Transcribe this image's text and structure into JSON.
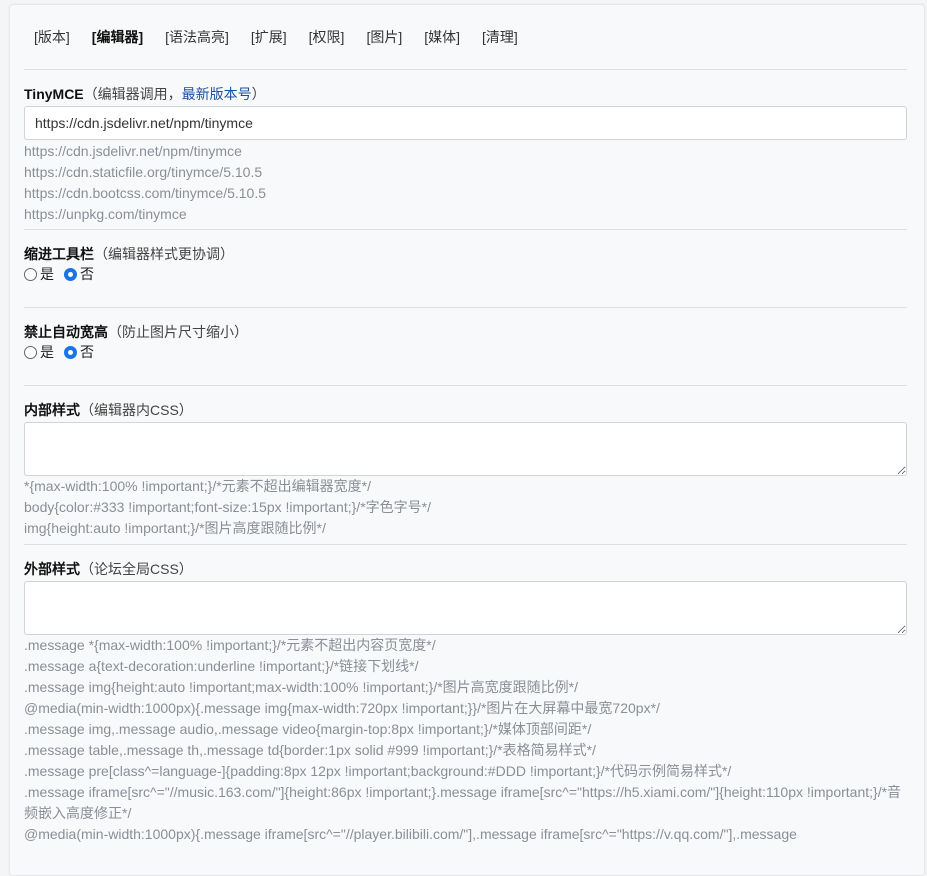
{
  "tabs": [
    {
      "label": "[版本]"
    },
    {
      "label": "[编辑器]"
    },
    {
      "label": "[语法高亮]"
    },
    {
      "label": "[扩展]"
    },
    {
      "label": "[权限]"
    },
    {
      "label": "[图片]"
    },
    {
      "label": "[媒体]"
    },
    {
      "label": "[清理]"
    }
  ],
  "tinymce": {
    "title": "TinyMCE",
    "note_prefix": "（编辑器调用，",
    "link": "最新版本号",
    "note_suffix": "）",
    "value": "https://cdn.jsdelivr.net/npm/tinymce",
    "hints": [
      "https://cdn.jsdelivr.net/npm/tinymce",
      "https://cdn.staticfile.org/tinymce/5.10.5",
      "https://cdn.bootcss.com/tinymce/5.10.5",
      "https://unpkg.com/tinymce"
    ]
  },
  "indent_toolbar": {
    "title": "缩进工具栏",
    "note": "（编辑器样式更协调）",
    "yes": "是",
    "no": "否",
    "selected": "否"
  },
  "no_auto_width": {
    "title": "禁止自动宽高",
    "note": "（防止图片尺寸缩小）",
    "yes": "是",
    "no": "否",
    "selected": "否"
  },
  "inner_css": {
    "title": "内部样式",
    "note": "（编辑器内CSS）",
    "value": "",
    "hints": [
      "*{max-width:100% !important;}/*元素不超出编辑器宽度*/",
      "body{color:#333 !important;font-size:15px !important;}/*字色字号*/",
      "img{height:auto !important;}/*图片高度跟随比例*/"
    ]
  },
  "outer_css": {
    "title": "外部样式",
    "note": "（论坛全局CSS）",
    "value": "",
    "hints": [
      ".message *{max-width:100% !important;}/*元素不超出内容页宽度*/",
      ".message a{text-decoration:underline !important;}/*链接下划线*/",
      ".message img{height:auto !important;max-width:100% !important;}/*图片高宽度跟随比例*/",
      "@media(min-width:1000px){.message img{max-width:720px !important;}}/*图片在大屏幕中最宽720px*/",
      ".message img,.message audio,.message video{margin-top:8px !important;}/*媒体顶部间距*/",
      ".message table,.message th,.message td{border:1px solid #999 !important;}/*表格简易样式*/",
      ".message pre[class^=language-]{padding:8px 12px !important;background:#DDD !important;}/*代码示例简易样式*/",
      ".message iframe[src^=\"//music.163.com/\"]{height:86px !important;}.message iframe[src^=\"https://h5.xiami.com/\"]{height:110px !important;}/*音频嵌入高度修正*/",
      "@media(min-width:1000px){.message iframe[src^=\"//player.bilibili.com/\"],.message iframe[src^=\"https://v.qq.com/\"],.message"
    ]
  }
}
